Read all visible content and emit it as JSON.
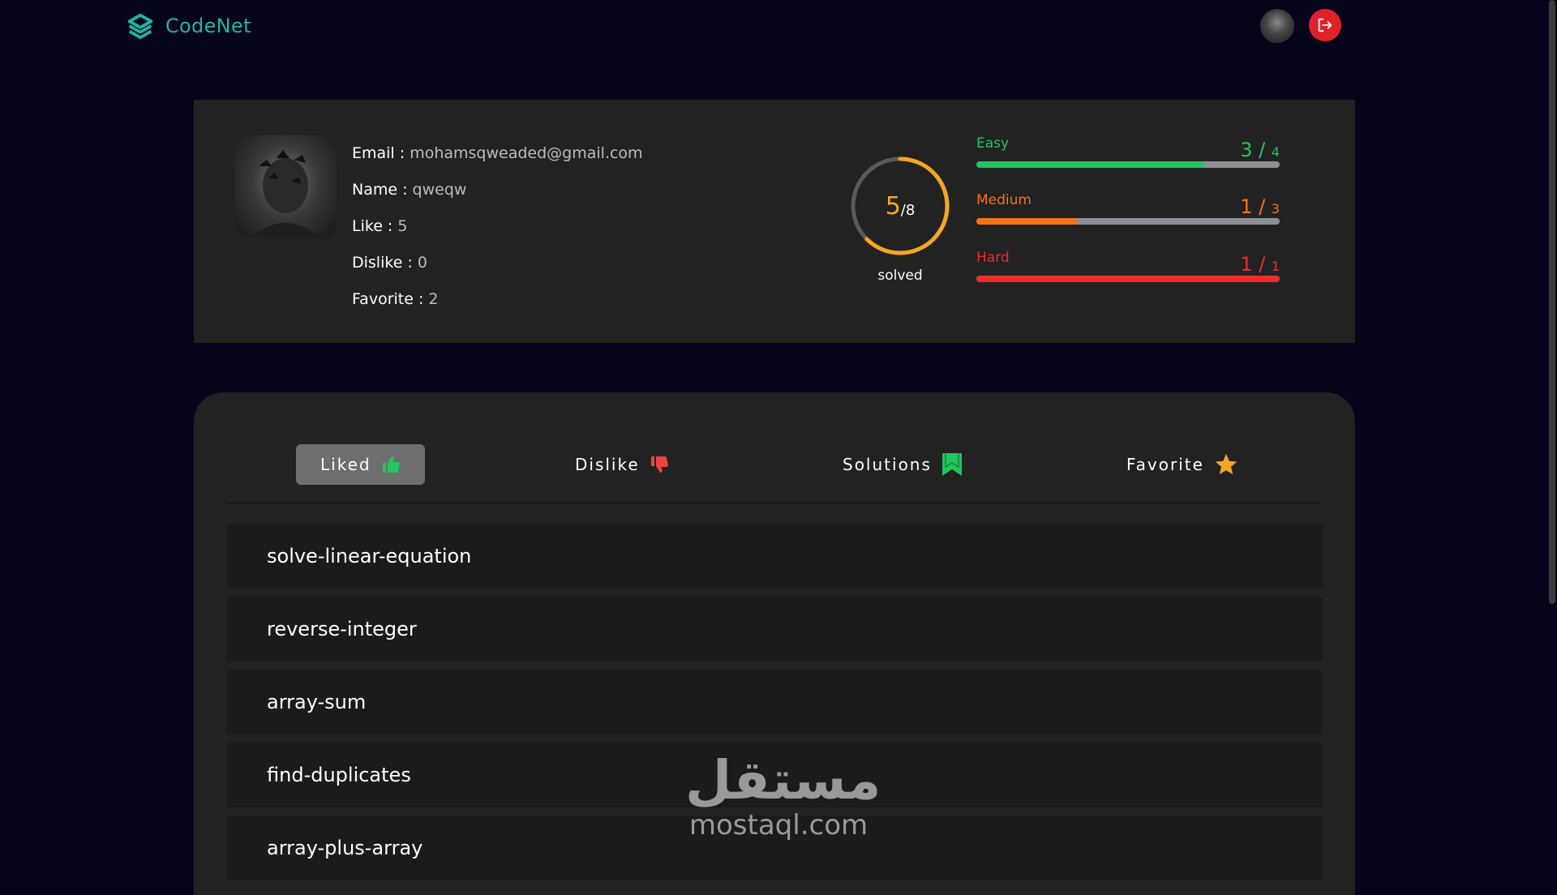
{
  "header": {
    "app_name": "CodeNet",
    "brand_color": "#1fb5a3",
    "logout_color": "#e0212a"
  },
  "profile": {
    "email_label": "Email :",
    "email": "mohamsqweaded@gmail.com",
    "name_label": "Name :",
    "name": "qweqw",
    "like_label": "Like :",
    "like": "5",
    "dislike_label": "Dislike :",
    "dislike": "0",
    "favorite_label": "Favorite :",
    "favorite": "2"
  },
  "progress": {
    "solved": "5",
    "total": "8",
    "solved_fraction": 0.625,
    "label": "solved",
    "ring_color": "#f5a623",
    "difficulties": [
      {
        "name": "Easy",
        "solved": "3",
        "sep": " / ",
        "total": "4",
        "fraction": 0.75,
        "color": "#22c55e"
      },
      {
        "name": "Medium",
        "solved": "1",
        "sep": " / ",
        "total": "3",
        "fraction": 0.333,
        "color": "#f97316"
      },
      {
        "name": "Hard",
        "solved": "1",
        "sep": " / ",
        "total": "1",
        "fraction": 1.0,
        "color": "#ef2b2b"
      }
    ]
  },
  "tabs": [
    {
      "label": "Liked",
      "icon": "thumbs-up-icon",
      "active": true
    },
    {
      "label": "Dislike",
      "icon": "thumbs-down-icon",
      "active": false
    },
    {
      "label": "Solutions",
      "icon": "bookmark-icon",
      "active": false
    },
    {
      "label": "Favorite",
      "icon": "star-icon",
      "active": false
    }
  ],
  "problems": [
    "solve-linear-equation",
    "reverse-integer",
    "array-sum",
    "find-duplicates",
    "array-plus-array"
  ],
  "watermark": {
    "arabic": "مستقل",
    "latin": "mostaql.com"
  }
}
